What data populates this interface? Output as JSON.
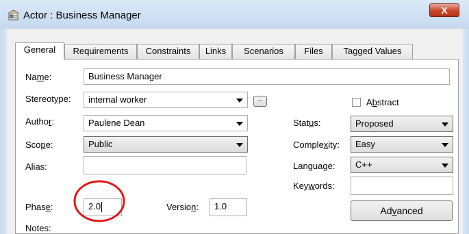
{
  "window": {
    "title": "Actor : Business Manager",
    "close_glyph": "X"
  },
  "tabs": [
    {
      "label": "General",
      "active": true
    },
    {
      "label": "Requirements"
    },
    {
      "label": "Constraints"
    },
    {
      "label": "Links"
    },
    {
      "label": "Scenarios"
    },
    {
      "label": "Files"
    },
    {
      "label": "Tagged Values"
    }
  ],
  "form": {
    "name": {
      "label_pre": "Na",
      "label_u": "m",
      "label_post": "e:",
      "value": "Business Manager"
    },
    "stereotype": {
      "label_pre": "Stereot",
      "label_u": "y",
      "label_post": "pe:",
      "value": "internal worker",
      "browse_label": "..."
    },
    "abstract": {
      "label_pre": "A",
      "label_u": "b",
      "label_post": "stract",
      "checked": false
    },
    "author": {
      "label_pre": "Autho",
      "label_u": "r",
      "label_post": ":",
      "value": "Paulene Dean"
    },
    "status": {
      "label_pre": "Stat",
      "label_u": "u",
      "label_post": "s:",
      "value": "Proposed"
    },
    "scope": {
      "label_pre": "Sco",
      "label_u": "p",
      "label_post": "e:",
      "value": "Public"
    },
    "complexity": {
      "label_pre": "Comple",
      "label_u": "x",
      "label_post": "ity:",
      "value": "Easy"
    },
    "alias": {
      "label": "Alias:",
      "value": ""
    },
    "language": {
      "label_pre": "Langua",
      "label_u": "g",
      "label_post": "e:",
      "value": "C++"
    },
    "keywords": {
      "label_pre": "Key",
      "label_u": "w",
      "label_post": "ords:",
      "value": ""
    },
    "phase": {
      "label_pre": "Phas",
      "label_u": "e",
      "label_post": ":",
      "value": "2.0"
    },
    "version": {
      "label_pre": "Versio",
      "label_u": "n",
      "label_post": ":",
      "value": "1.0"
    },
    "advanced": {
      "label_pre": "Ad",
      "label_u": "v",
      "label_post": "anced"
    },
    "notes": {
      "label": "Notes:"
    }
  },
  "colors": {
    "annotation": "#e01818",
    "close_button": "#c9442a"
  },
  "icons": {
    "app": "actor-properties-icon",
    "close": "close-icon",
    "dropdown": "chevron-down-icon"
  }
}
